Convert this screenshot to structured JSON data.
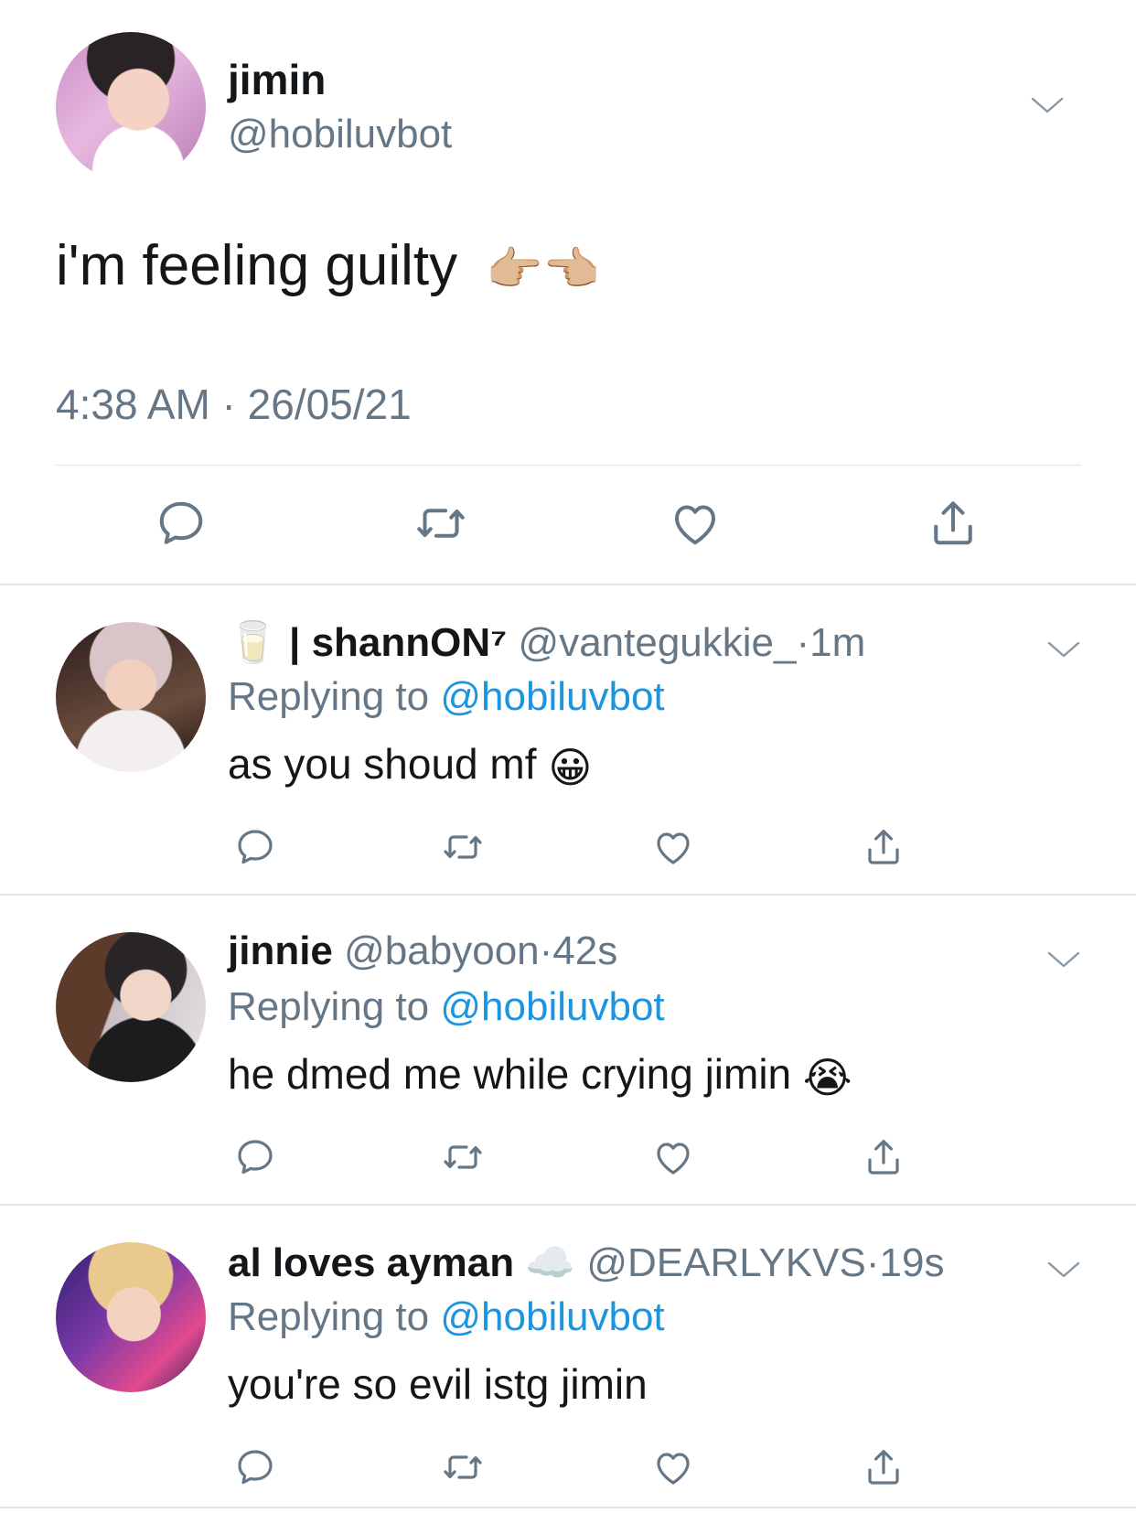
{
  "main_tweet": {
    "name": "jimin",
    "handle": "@hobiluvbot",
    "text": "i'm feeling guilty",
    "emojis": [
      "👉🏼",
      "👈🏼"
    ],
    "timestamp": "4:38 AM · 26/05/21"
  },
  "replies": [
    {
      "name_prefix_emoji": "🥛",
      "name": "| shannON⁷",
      "handle": "@vantegukkie_",
      "time": "1m",
      "replying_label": "Replying to",
      "mention": "@hobiluvbot",
      "text": "as you shoud mf",
      "text_emoji": "😀"
    },
    {
      "name": "jinnie",
      "handle": "@babyoon",
      "time": "42s",
      "replying_label": "Replying to",
      "mention": "@hobiluvbot",
      "text": "he dmed me while crying jimin",
      "text_emoji": "😭"
    },
    {
      "name": "al loves ayman",
      "name_suffix_emoji": "☁️",
      "handle": "@DEARLYKVS",
      "time": "19s",
      "replying_label": "Replying to",
      "mention": "@hobiluvbot",
      "text": "you're so evil istg jimin"
    }
  ],
  "separator": "·",
  "icons": [
    "reply-icon",
    "retweet-icon",
    "like-icon",
    "share-icon",
    "chevron-down-icon"
  ],
  "colors": {
    "text": "#14171a",
    "secondary": "#657786",
    "mention": "#1b95e0",
    "icon": "#657786"
  }
}
